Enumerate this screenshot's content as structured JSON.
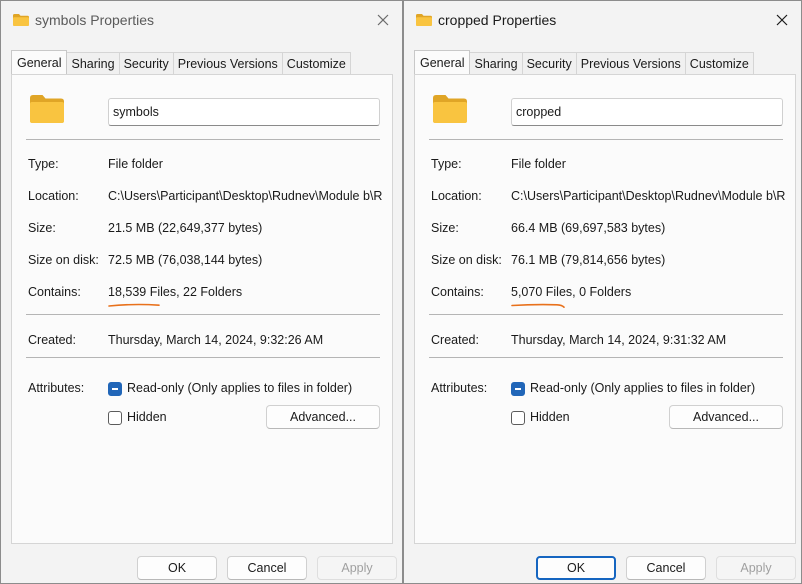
{
  "dialogs": [
    {
      "title": "symbols Properties",
      "tabs": [
        "General",
        "Sharing",
        "Security",
        "Previous Versions",
        "Customize"
      ],
      "name_value": "symbols",
      "rows": {
        "type": {
          "label": "Type:",
          "value": "File folder"
        },
        "location": {
          "label": "Location:",
          "value": "C:\\Users\\Participant\\Desktop\\Rudnev\\Module b\\R"
        },
        "size": {
          "label": "Size:",
          "value": "21.5 MB (22,649,377 bytes)"
        },
        "size_on_disk": {
          "label": "Size on disk:",
          "value": "72.5 MB (76,038,144 bytes)"
        },
        "contains": {
          "label": "Contains:",
          "value": "18,539 Files, 22 Folders"
        },
        "created": {
          "label": "Created:",
          "value": "Thursday, March 14, 2024, 9:32:26 AM"
        }
      },
      "attributes": {
        "label": "Attributes:",
        "readonly": {
          "label": "Read-only (Only applies to files in folder)",
          "checked": true
        },
        "hidden": {
          "label": "Hidden",
          "checked": false
        },
        "advanced": "Advanced..."
      },
      "buttons": {
        "ok": "OK",
        "cancel": "Cancel",
        "apply": "Apply"
      }
    },
    {
      "title": "cropped Properties",
      "tabs": [
        "General",
        "Sharing",
        "Security",
        "Previous Versions",
        "Customize"
      ],
      "name_value": "cropped",
      "rows": {
        "type": {
          "label": "Type:",
          "value": "File folder"
        },
        "location": {
          "label": "Location:",
          "value": "C:\\Users\\Participant\\Desktop\\Rudnev\\Module b\\R"
        },
        "size": {
          "label": "Size:",
          "value": "66.4 MB (69,697,583 bytes)"
        },
        "size_on_disk": {
          "label": "Size on disk:",
          "value": "76.1 MB (79,814,656 bytes)"
        },
        "contains": {
          "label": "Contains:",
          "value": "5,070 Files, 0 Folders"
        },
        "created": {
          "label": "Created:",
          "value": "Thursday, March 14, 2024, 9:31:32 AM"
        }
      },
      "attributes": {
        "label": "Attributes:",
        "readonly": {
          "label": "Read-only (Only applies to files in folder)",
          "checked": true
        },
        "hidden": {
          "label": "Hidden",
          "checked": false
        },
        "advanced": "Advanced..."
      },
      "buttons": {
        "ok": "OK",
        "cancel": "Cancel",
        "apply": "Apply"
      }
    }
  ],
  "colors": {
    "folder_yellow": "#f9c440",
    "checkbox_accent": "#2166b8",
    "annotation_underline": "#e8711c",
    "desktop_background": "#1c2624"
  }
}
